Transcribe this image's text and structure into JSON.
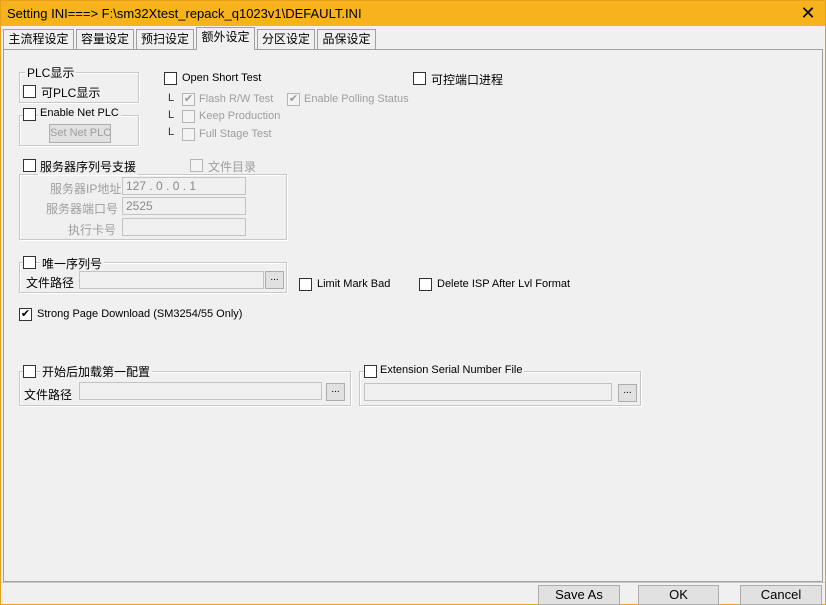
{
  "window": {
    "title": "Setting  INI===> F:\\sm32Xtest_repack_q1023v1\\DEFAULT.INI",
    "close_glyph": "✕"
  },
  "tabs": [
    "主流程设定",
    "容量设定",
    "预扫设定",
    "额外设定",
    "分区设定",
    "品保设定"
  ],
  "active_tab": "额外设定",
  "check_glyph": "✔",
  "plc": {
    "group_title": "PLC显示",
    "show_plc_label": "可PLC显示",
    "enable_net_plc_label": "Enable Net PLC",
    "set_net_plc_button": "Set Net PLC"
  },
  "short_test": {
    "open_short_label": "Open Short Test",
    "tree_mark": "L",
    "flash_rw_label": "Flash R/W Test",
    "enable_polling_label": "Enable Polling Status",
    "keep_production_label": "Keep Production",
    "full_stage_label": "Full Stage Test"
  },
  "controllable_port_label": "可控端口进程",
  "server": {
    "serial_support_label": "服务器序列号支援",
    "file_dir_label": "文件目录",
    "ip_label": "服务器IP地址",
    "ip_value": "127 .  0  .  0  .  1",
    "port_label": "服务器端口号",
    "port_value": "2525",
    "card_label": "执行卡号",
    "card_value": ""
  },
  "unique_serial": {
    "title": "唯一序列号",
    "path_label": "文件路径",
    "path_value": "",
    "browse_label": "..."
  },
  "limit_mark_bad_label": "Limit Mark Bad",
  "delete_isp_label": "Delete ISP After Lvl Format",
  "strong_page_label": "Strong Page Download (SM3254/55 Only)",
  "load_first_config": {
    "title": "开始后加载第一配置",
    "path_label": "文件路径",
    "path_value": "",
    "browse_label": "..."
  },
  "extension_serial": {
    "title": "Extension Serial Number File",
    "path_value": "",
    "browse_label": "..."
  },
  "buttons": {
    "save_as": "Save  As",
    "ok": "OK",
    "cancel": "Cancel"
  }
}
